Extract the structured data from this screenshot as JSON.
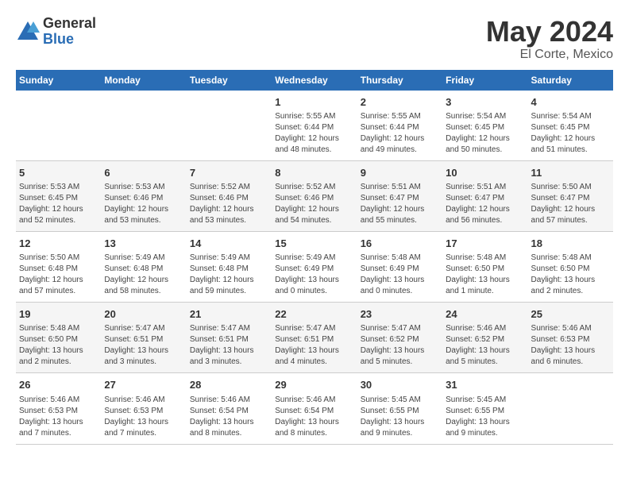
{
  "header": {
    "logo_general": "General",
    "logo_blue": "Blue",
    "title": "May 2024",
    "subtitle": "El Corte, Mexico"
  },
  "days_of_week": [
    "Sunday",
    "Monday",
    "Tuesday",
    "Wednesday",
    "Thursday",
    "Friday",
    "Saturday"
  ],
  "weeks": [
    [
      {
        "day": "",
        "info": ""
      },
      {
        "day": "",
        "info": ""
      },
      {
        "day": "",
        "info": ""
      },
      {
        "day": "1",
        "info": "Sunrise: 5:55 AM\nSunset: 6:44 PM\nDaylight: 12 hours\nand 48 minutes."
      },
      {
        "day": "2",
        "info": "Sunrise: 5:55 AM\nSunset: 6:44 PM\nDaylight: 12 hours\nand 49 minutes."
      },
      {
        "day": "3",
        "info": "Sunrise: 5:54 AM\nSunset: 6:45 PM\nDaylight: 12 hours\nand 50 minutes."
      },
      {
        "day": "4",
        "info": "Sunrise: 5:54 AM\nSunset: 6:45 PM\nDaylight: 12 hours\nand 51 minutes."
      }
    ],
    [
      {
        "day": "5",
        "info": "Sunrise: 5:53 AM\nSunset: 6:45 PM\nDaylight: 12 hours\nand 52 minutes."
      },
      {
        "day": "6",
        "info": "Sunrise: 5:53 AM\nSunset: 6:46 PM\nDaylight: 12 hours\nand 53 minutes."
      },
      {
        "day": "7",
        "info": "Sunrise: 5:52 AM\nSunset: 6:46 PM\nDaylight: 12 hours\nand 53 minutes."
      },
      {
        "day": "8",
        "info": "Sunrise: 5:52 AM\nSunset: 6:46 PM\nDaylight: 12 hours\nand 54 minutes."
      },
      {
        "day": "9",
        "info": "Sunrise: 5:51 AM\nSunset: 6:47 PM\nDaylight: 12 hours\nand 55 minutes."
      },
      {
        "day": "10",
        "info": "Sunrise: 5:51 AM\nSunset: 6:47 PM\nDaylight: 12 hours\nand 56 minutes."
      },
      {
        "day": "11",
        "info": "Sunrise: 5:50 AM\nSunset: 6:47 PM\nDaylight: 12 hours\nand 57 minutes."
      }
    ],
    [
      {
        "day": "12",
        "info": "Sunrise: 5:50 AM\nSunset: 6:48 PM\nDaylight: 12 hours\nand 57 minutes."
      },
      {
        "day": "13",
        "info": "Sunrise: 5:49 AM\nSunset: 6:48 PM\nDaylight: 12 hours\nand 58 minutes."
      },
      {
        "day": "14",
        "info": "Sunrise: 5:49 AM\nSunset: 6:48 PM\nDaylight: 12 hours\nand 59 minutes."
      },
      {
        "day": "15",
        "info": "Sunrise: 5:49 AM\nSunset: 6:49 PM\nDaylight: 13 hours\nand 0 minutes."
      },
      {
        "day": "16",
        "info": "Sunrise: 5:48 AM\nSunset: 6:49 PM\nDaylight: 13 hours\nand 0 minutes."
      },
      {
        "day": "17",
        "info": "Sunrise: 5:48 AM\nSunset: 6:50 PM\nDaylight: 13 hours\nand 1 minute."
      },
      {
        "day": "18",
        "info": "Sunrise: 5:48 AM\nSunset: 6:50 PM\nDaylight: 13 hours\nand 2 minutes."
      }
    ],
    [
      {
        "day": "19",
        "info": "Sunrise: 5:48 AM\nSunset: 6:50 PM\nDaylight: 13 hours\nand 2 minutes."
      },
      {
        "day": "20",
        "info": "Sunrise: 5:47 AM\nSunset: 6:51 PM\nDaylight: 13 hours\nand 3 minutes."
      },
      {
        "day": "21",
        "info": "Sunrise: 5:47 AM\nSunset: 6:51 PM\nDaylight: 13 hours\nand 3 minutes."
      },
      {
        "day": "22",
        "info": "Sunrise: 5:47 AM\nSunset: 6:51 PM\nDaylight: 13 hours\nand 4 minutes."
      },
      {
        "day": "23",
        "info": "Sunrise: 5:47 AM\nSunset: 6:52 PM\nDaylight: 13 hours\nand 5 minutes."
      },
      {
        "day": "24",
        "info": "Sunrise: 5:46 AM\nSunset: 6:52 PM\nDaylight: 13 hours\nand 5 minutes."
      },
      {
        "day": "25",
        "info": "Sunrise: 5:46 AM\nSunset: 6:53 PM\nDaylight: 13 hours\nand 6 minutes."
      }
    ],
    [
      {
        "day": "26",
        "info": "Sunrise: 5:46 AM\nSunset: 6:53 PM\nDaylight: 13 hours\nand 7 minutes."
      },
      {
        "day": "27",
        "info": "Sunrise: 5:46 AM\nSunset: 6:53 PM\nDaylight: 13 hours\nand 7 minutes."
      },
      {
        "day": "28",
        "info": "Sunrise: 5:46 AM\nSunset: 6:54 PM\nDaylight: 13 hours\nand 8 minutes."
      },
      {
        "day": "29",
        "info": "Sunrise: 5:46 AM\nSunset: 6:54 PM\nDaylight: 13 hours\nand 8 minutes."
      },
      {
        "day": "30",
        "info": "Sunrise: 5:45 AM\nSunset: 6:55 PM\nDaylight: 13 hours\nand 9 minutes."
      },
      {
        "day": "31",
        "info": "Sunrise: 5:45 AM\nSunset: 6:55 PM\nDaylight: 13 hours\nand 9 minutes."
      },
      {
        "day": "",
        "info": ""
      }
    ]
  ]
}
